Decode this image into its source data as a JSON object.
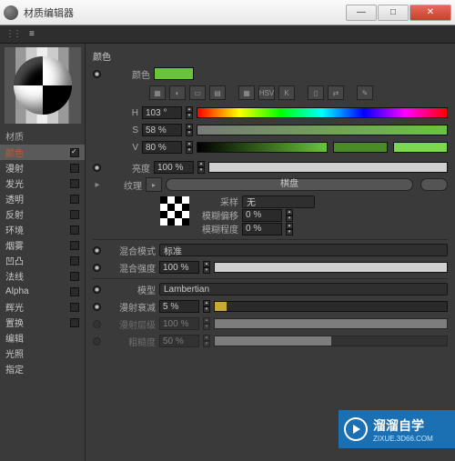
{
  "window": {
    "title": "材质编辑器"
  },
  "sidebar": {
    "header": "材质",
    "items": [
      {
        "label": "颜色",
        "checked": true,
        "active": true
      },
      {
        "label": "漫射",
        "checked": false
      },
      {
        "label": "发光",
        "checked": false
      },
      {
        "label": "透明",
        "checked": false
      },
      {
        "label": "反射",
        "checked": false
      },
      {
        "label": "环境",
        "checked": false
      },
      {
        "label": "烟雾",
        "checked": false
      },
      {
        "label": "凹凸",
        "checked": false
      },
      {
        "label": "法线",
        "checked": false
      },
      {
        "label": "Alpha",
        "checked": false
      },
      {
        "label": "辉光",
        "checked": false
      },
      {
        "label": "置换",
        "checked": false
      }
    ],
    "extra": [
      "编辑",
      "光照",
      "指定"
    ]
  },
  "color": {
    "header": "颜色",
    "label": "颜色",
    "swatch": "#6ac43a",
    "h": {
      "label": "H",
      "value": "103 °"
    },
    "s": {
      "label": "S",
      "value": "58 %"
    },
    "v": {
      "label": "V",
      "value": "80 %"
    },
    "hsv_btn": "HSV"
  },
  "brightness": {
    "label": "亮度",
    "value": "100 %"
  },
  "texture": {
    "label": "纹理",
    "button": "棋盘",
    "sample_label": "采样",
    "sample_value": "无",
    "blur_offset_label": "模糊偏移",
    "blur_offset_value": "0 %",
    "blur_scale_label": "模糊程度",
    "blur_scale_value": "0 %"
  },
  "mix": {
    "mode_label": "混合模式",
    "mode_value": "标准",
    "strength_label": "混合强度",
    "strength_value": "100 %"
  },
  "model": {
    "label": "模型",
    "value": "Lambertian",
    "falloff_label": "漫射衰减",
    "falloff_value": "5 %",
    "level_label": "漫射层级",
    "level_value": "100 %",
    "rough_label": "粗糙度",
    "rough_value": "50 %"
  },
  "watermark": {
    "title": "溜溜自学",
    "url": "ZIXUE.3D66.COM"
  }
}
